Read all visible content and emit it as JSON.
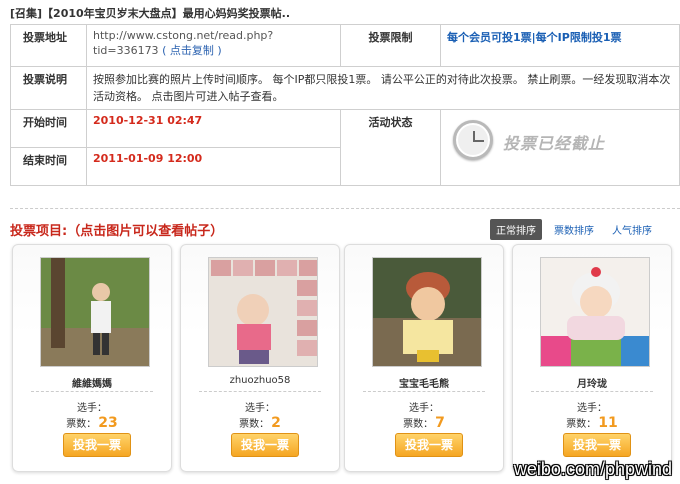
{
  "header": {
    "title": "[召集]【2010年宝贝岁末大盘点】最用心妈妈奖投票帖.."
  },
  "info": {
    "vote_url_label": "投票地址",
    "vote_url": "http://www.cstong.net/read.php?tid=336173",
    "copy_link": "( 点击复制 )",
    "vote_limit_label": "投票限制",
    "vote_limit": "每个会员可投1票|每个IP限制投1票",
    "vote_desc_label": "投票说明",
    "vote_desc": "按照参加比赛的照片上传时间顺序。 每个IP都只限投1票。 请公平公正的对待此次投票。 禁止刷票。一经发现取消本次活动资格。 点击图片可进入帖子查看。",
    "start_label": "开始时间",
    "start_time": "2010-12-31 02:47",
    "end_label": "结束时间",
    "end_time": "2011-01-09 12:00",
    "status_label": "活动状态",
    "status_text": "投票已经截止"
  },
  "section": {
    "title": "投票项目:（点击图片可以查看帖子）",
    "sorts": [
      {
        "label": "正常排序",
        "active": true
      },
      {
        "label": "票数排序",
        "active": false
      },
      {
        "label": "人气排序",
        "active": false
      }
    ]
  },
  "cards": [
    {
      "name": "維維媽媽",
      "candidate_label": "选手：",
      "votes_label": "票数：",
      "votes": "23",
      "button": "投我一票"
    },
    {
      "name": "zhuozhuo58",
      "candidate_label": "选手：",
      "votes_label": "票数：",
      "votes": "2",
      "button": "投我一票"
    },
    {
      "name": "宝宝毛毛熊",
      "candidate_label": "选手：",
      "votes_label": "票数：",
      "votes": "7",
      "button": "投我一票"
    },
    {
      "name": "月玲珑",
      "candidate_label": "选手：",
      "votes_label": "票数：",
      "votes": "11",
      "button": "投我一票"
    }
  ],
  "watermark": "weibo.com/phpwind"
}
